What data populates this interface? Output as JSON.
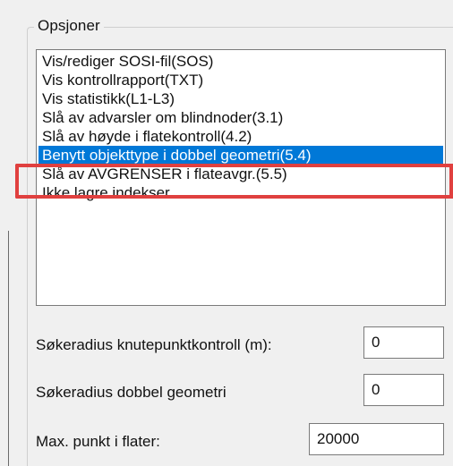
{
  "options_group": {
    "label": "Opsjoner",
    "items": [
      {
        "label": "Vis/rediger SOSI-fil(SOS)",
        "selected": false
      },
      {
        "label": "Vis kontrollrapport(TXT)",
        "selected": false
      },
      {
        "label": "Vis statistikk(L1-L3)",
        "selected": false
      },
      {
        "label": "Slå av advarsler om blindnoder(3.1)",
        "selected": false
      },
      {
        "label": "Slå av høyde i flatekontroll(4.2)",
        "selected": false
      },
      {
        "label": "Benytt objekttype i dobbel geometri(5.4)",
        "selected": true
      },
      {
        "label": "Slå av AVGRENSER i flateavgr.(5.5)",
        "selected": false
      },
      {
        "label": "Ikke lagre indekser",
        "selected": false
      }
    ]
  },
  "fields": {
    "knutepunkt": {
      "label": "Søkeradius knutepunktkontroll (m):",
      "value": "0"
    },
    "dobbel": {
      "label": "Søkeradius dobbel geometri",
      "value": "0"
    },
    "maxpunkt": {
      "label": "Max. punkt i flater:",
      "value": "20000"
    }
  },
  "colors": {
    "selection": "#0078d7",
    "highlight": "#e0403f"
  }
}
